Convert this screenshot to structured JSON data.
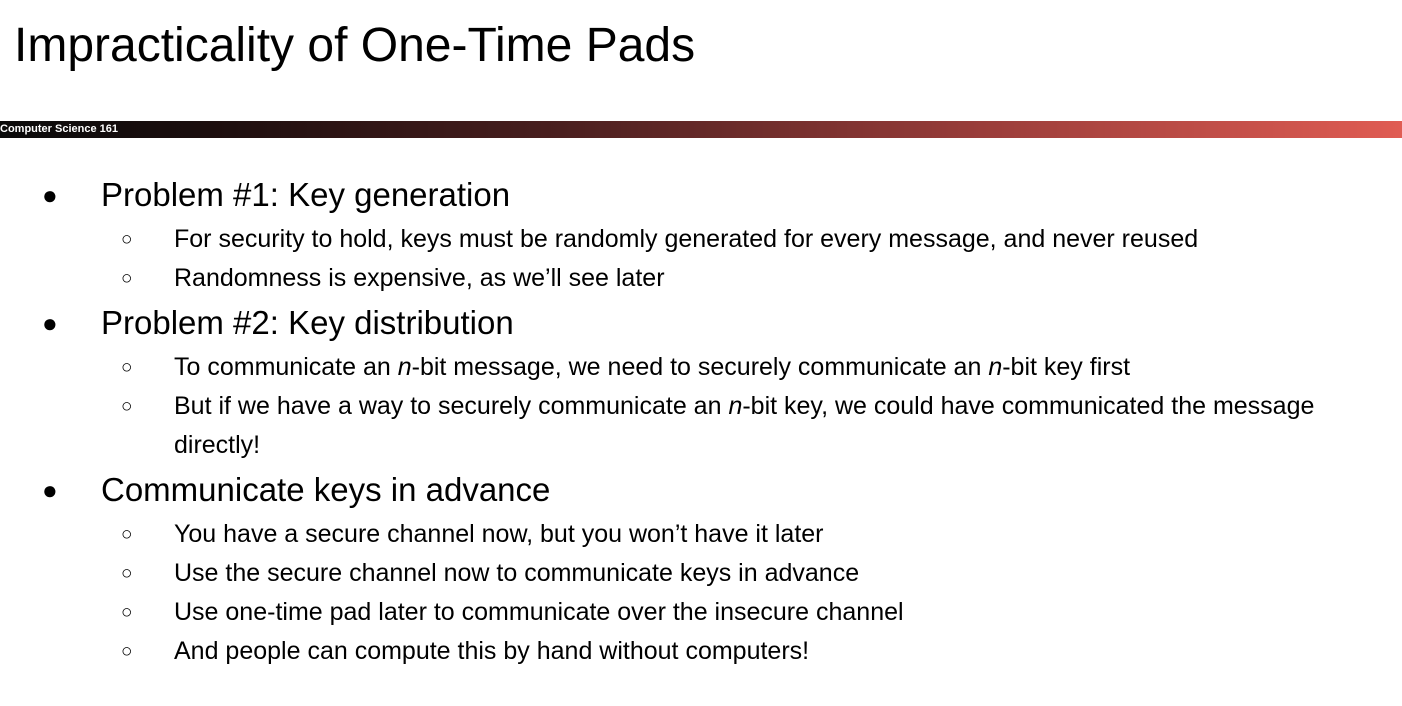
{
  "title": "Impracticality of One-Time Pads",
  "course_label": "Computer Science 161",
  "markers": {
    "bullet": "●",
    "sub": "○"
  },
  "sections": [
    {
      "heading": "Problem #1: Key generation",
      "items": [
        {
          "parts": [
            {
              "t": "For security to hold, keys must be randomly generated for every message, and never reused"
            }
          ]
        },
        {
          "parts": [
            {
              "t": "Randomness is expensive, as we’ll see later"
            }
          ]
        }
      ]
    },
    {
      "heading": "Problem #2: Key distribution",
      "items": [
        {
          "parts": [
            {
              "t": "To communicate an "
            },
            {
              "t": "n",
              "i": true
            },
            {
              "t": "-bit message, we need to securely communicate an "
            },
            {
              "t": "n",
              "i": true
            },
            {
              "t": "-bit key first"
            }
          ]
        },
        {
          "parts": [
            {
              "t": "But if we have a way to securely communicate an "
            },
            {
              "t": "n",
              "i": true
            },
            {
              "t": "-bit key, we could have communicated the message directly!"
            }
          ]
        }
      ]
    },
    {
      "heading": "Communicate keys in advance",
      "items": [
        {
          "parts": [
            {
              "t": "You have a secure channel now, but you won’t have it later"
            }
          ]
        },
        {
          "parts": [
            {
              "t": "Use the secure channel now to communicate keys in advance"
            }
          ]
        },
        {
          "parts": [
            {
              "t": "Use one-time pad later to communicate over the insecure channel"
            }
          ]
        },
        {
          "parts": [
            {
              "t": "And people can compute this by hand without computers!"
            }
          ]
        }
      ]
    }
  ]
}
